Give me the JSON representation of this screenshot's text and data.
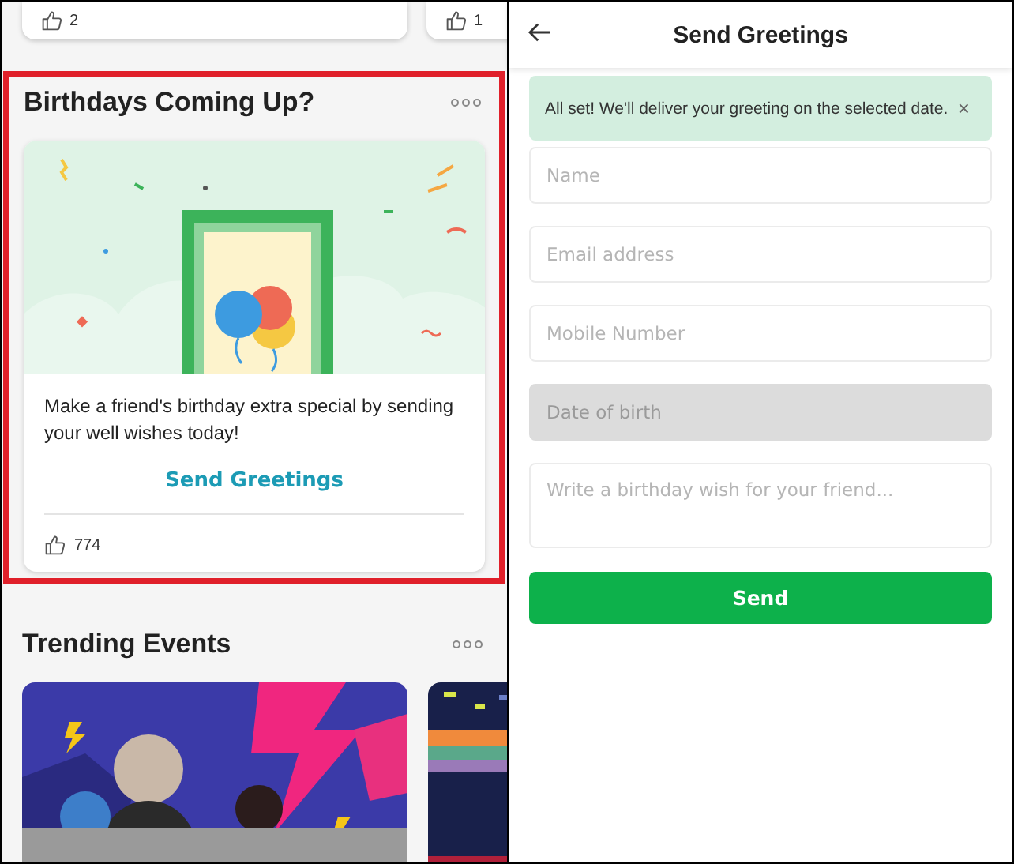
{
  "feed": {
    "top_cards": [
      {
        "likes": "2"
      },
      {
        "likes": "1"
      }
    ],
    "birthday_section": {
      "title": "Birthdays Coming Up?",
      "highlighted": true,
      "text": "Make a friend's birthday extra special by sending your well wishes today!",
      "action": "Send Greetings",
      "likes": "774"
    },
    "trending": {
      "title": "Trending Events"
    }
  },
  "send_greetings": {
    "title": "Send Greetings",
    "banner": {
      "message": "All set! We'll deliver your greeting on the selected date.",
      "dismiss": "×"
    },
    "fields": [
      {
        "kind": "input",
        "placeholder": "Name",
        "disabled": false
      },
      {
        "kind": "input",
        "placeholder": "Email address",
        "disabled": false
      },
      {
        "kind": "input",
        "placeholder": "Mobile Number",
        "disabled": false
      },
      {
        "kind": "input",
        "placeholder": "Date of birth",
        "disabled": true
      },
      {
        "kind": "textarea",
        "placeholder": "Write a birthday wish for your friend...",
        "disabled": false
      }
    ],
    "button": "Send"
  }
}
